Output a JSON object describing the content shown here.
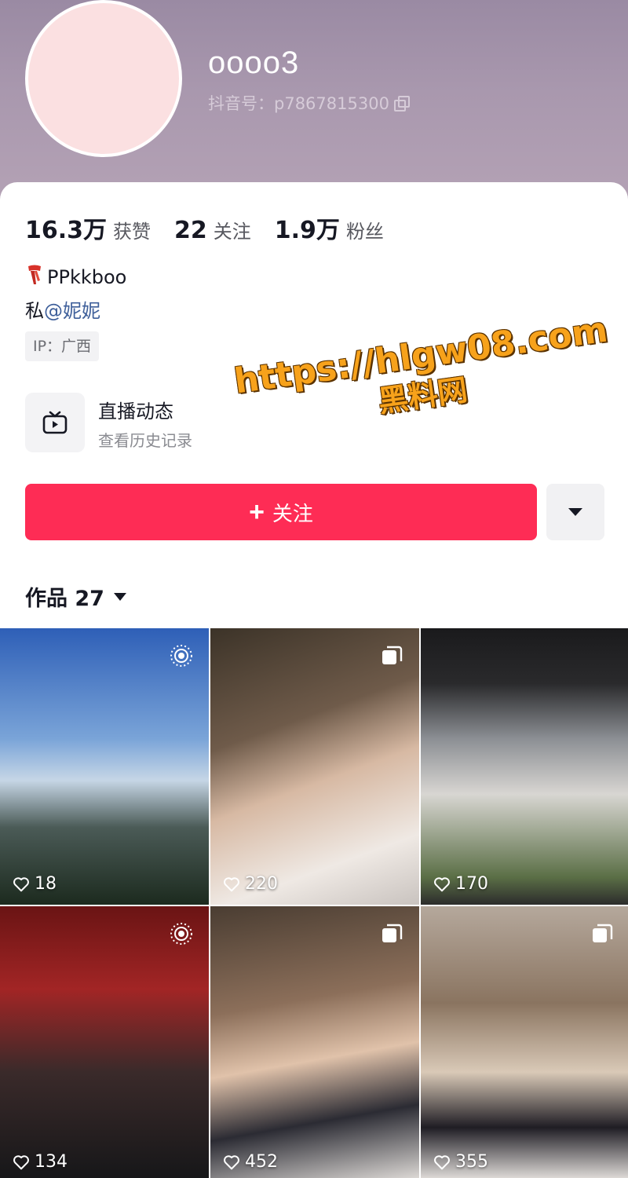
{
  "profile": {
    "nickname": "oooo3",
    "douyin_id": "抖音号：p7867815300"
  },
  "stats": [
    {
      "value": "16.3万",
      "label": "获赞"
    },
    {
      "value": "22",
      "label": "关注"
    },
    {
      "value": "1.9万",
      "label": "粉丝"
    }
  ],
  "bio": {
    "line1_icon": "scarf-icon",
    "line1": "PPkkboo",
    "line2_prefix": "私",
    "line2_mention": "@妮妮",
    "ip": "IP：广西"
  },
  "live": {
    "title": "直播动态",
    "subtitle": "查看历史记录",
    "icon": "tv-icon"
  },
  "watermark": {
    "url": "https://hlgw08.com",
    "name": "黑料网"
  },
  "actions": {
    "follow_label": "关注",
    "follow_icon": "plus-icon",
    "more_icon": "caret-down-icon"
  },
  "works": {
    "label": "作品 27",
    "items": [
      {
        "likes": "18",
        "badge": "live-photo-icon"
      },
      {
        "likes": "220",
        "badge": "gallery-icon"
      },
      {
        "likes": "170",
        "badge": ""
      },
      {
        "likes": "134",
        "badge": "live-photo-icon"
      },
      {
        "likes": "452",
        "badge": "gallery-icon"
      },
      {
        "likes": "355",
        "badge": "gallery-icon"
      }
    ]
  },
  "colors": {
    "accent": "#fe2c55",
    "mention": "#3e5f9a",
    "watermark": "#f7a21b"
  }
}
